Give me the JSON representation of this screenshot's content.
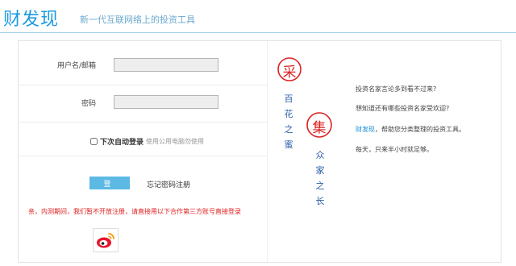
{
  "header": {
    "logo": "财发现",
    "tagline": "新一代互联网络上的投资工具"
  },
  "form": {
    "username_label": "用户名/邮箱",
    "username_value": "",
    "password_label": "密码",
    "password_value": "",
    "remember_label": "下次自动登录",
    "remember_hint": "使用公用电脑勿使用",
    "login_button": "登 录",
    "forgot_link": "忘记密码注册",
    "notice": "亲，内测期间，我们暂不开放注册，请直接用以下合作第三方账号直接登录"
  },
  "art": {
    "title_left": "采",
    "title_right": "集",
    "verse_left": [
      "百",
      "花",
      "之",
      "蜜"
    ],
    "verse_right": [
      "众",
      "家",
      "之",
      "长"
    ]
  },
  "info": {
    "line1": "投资名家言论多到看不过来?",
    "line2": "想知道还有哪些投资名家受欢迎?",
    "brand": "财发现",
    "line3_rest": "，帮助您分类整理的投资工具。",
    "line4": "每天，只来半小时就足够。"
  },
  "colors": {
    "brand_blue": "#1b9be0",
    "button_blue": "#5bb9e3",
    "notice_red": "#e02020",
    "seal_red": "#d22222",
    "verse_blue": "#2a5da8"
  },
  "icons": {
    "weibo": "weibo-icon"
  }
}
